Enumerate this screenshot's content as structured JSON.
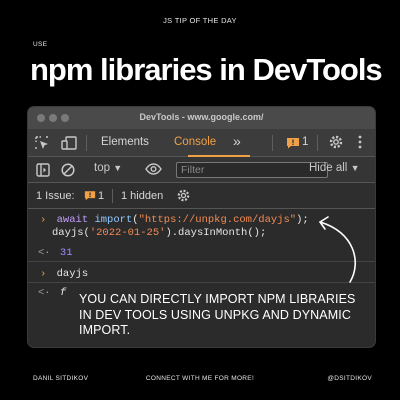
{
  "header": {
    "kicker": "JS TIP OF THE DAY",
    "use_label": "USE",
    "headline": "npm libraries in DevTools"
  },
  "window": {
    "title": "DevTools - www.google.com/",
    "tabs": [
      {
        "label": "Elements",
        "active": false
      },
      {
        "label": "Console",
        "active": true
      }
    ],
    "more_tabs": "»",
    "issues_badge": "1",
    "accent_color": "#f0a046",
    "filterbar": {
      "context": "top",
      "filter_placeholder": "Filter",
      "levels": "Hide all"
    },
    "issuebar": {
      "issues_label": "1 Issue:",
      "issues_count": "1",
      "hidden_label": "1 hidden"
    },
    "console": {
      "line1_kw": "await ",
      "line1_fn": "import",
      "line1_open": "(",
      "line1_str": "\"https://unpkg.com/dayjs\"",
      "line1_close": ");",
      "line2_a": "dayjs(",
      "line2_str": "'2022-01-25'",
      "line2_b": ").daysInMonth();",
      "result": "31",
      "cmd2": "dayjs",
      "result2": "f"
    }
  },
  "overlay_text": "YOU CAN DIRECTLY IMPORT NPM LIBRARIES IN DEV TOOLS USING UNPKG AND DYNAMIC IMPORT.",
  "footer": {
    "left": "DANIL SITDIKOV",
    "center": "CONNECT WITH ME FOR MORE!",
    "right": "@DSITDIKOV"
  }
}
